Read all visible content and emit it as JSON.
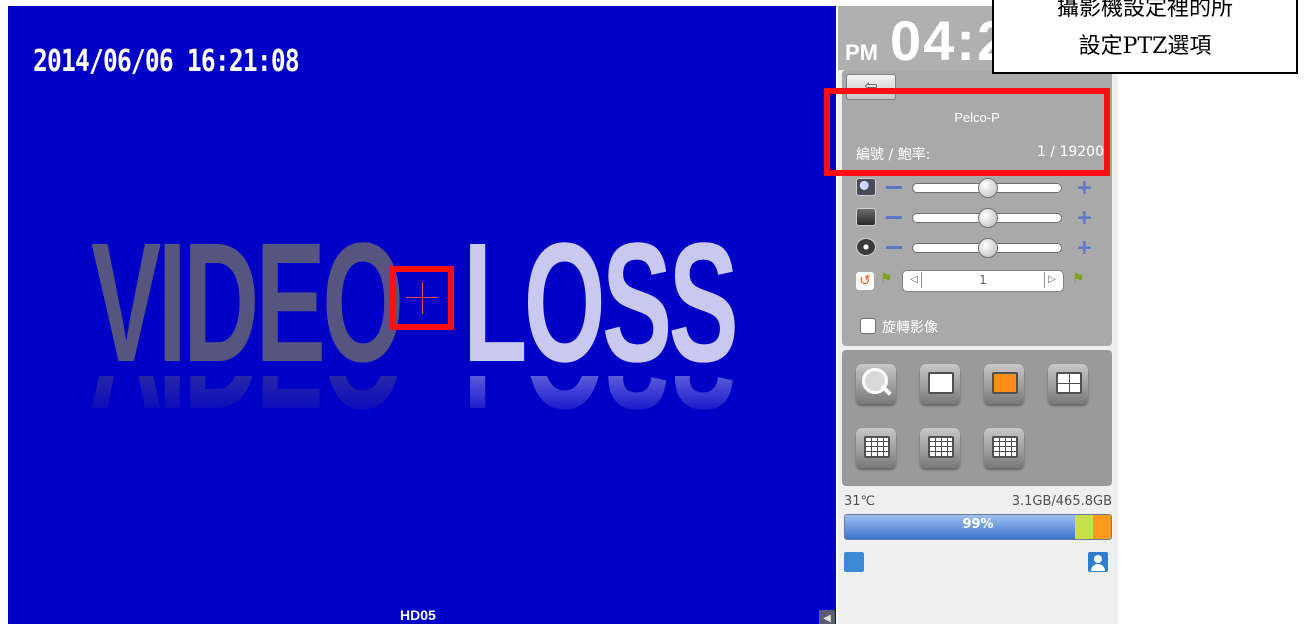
{
  "video": {
    "timestamp": "2014/06/06 16:21:08",
    "video_word": "VIDEO",
    "loss_word": "LOSS",
    "channel": "HD05"
  },
  "clock": {
    "ampm": "PM",
    "time": "04:2"
  },
  "ptz": {
    "protocol": "Pelco-P",
    "id_baud_label": "編號 / 鮑率:",
    "id_baud_value": "1 / 19200",
    "sliders": [
      {
        "name": "zoom",
        "level": 0.5
      },
      {
        "name": "focus",
        "level": 0.5
      },
      {
        "name": "iris",
        "level": 0.5
      }
    ],
    "preset_value": "1",
    "rotate_label": "旋轉影像",
    "rotate_checked": false
  },
  "layout": {
    "buttons": [
      "search",
      "pip",
      "single",
      "quad",
      "grid9",
      "grid13",
      "grid16"
    ],
    "selected": "single"
  },
  "status": {
    "temperature": "31℃",
    "disk": "3.1GB/465.8GB",
    "hdd_percent_text": "99%",
    "hdd_fill": 0.99
  },
  "callout": {
    "line1": "攝影機設定裡的所",
    "line2": "設定PTZ選項"
  },
  "colors": {
    "video_bg": "#0000c6",
    "highlight": "#ff1010",
    "accent": "#3b74cf",
    "selected_layout": "#ff8c1a"
  }
}
